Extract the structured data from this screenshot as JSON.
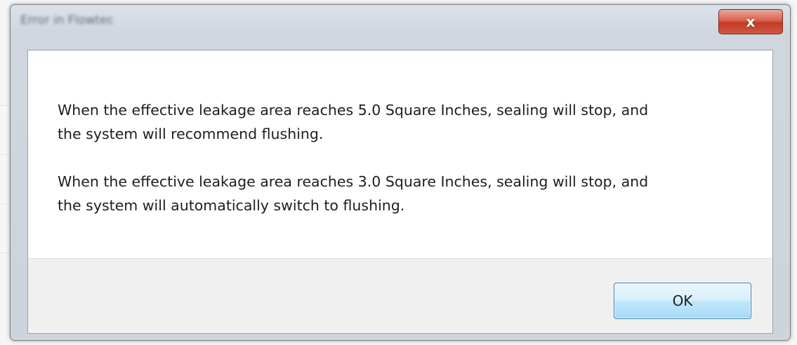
{
  "dialog": {
    "title": "Error in Flowtec",
    "close_glyph": "x",
    "messages": [
      "When the effective leakage area reaches 5.0 Square Inches, sealing will stop, and\nthe system will recommend flushing.",
      "When the effective leakage area reaches 3.0 Square Inches, sealing will stop, and\nthe system will automatically switch to flushing."
    ],
    "ok_label": "OK"
  },
  "colors": {
    "close_button": "#c33a25",
    "ok_border": "#3c7fb1",
    "ok_fill": "#bee6fd"
  }
}
